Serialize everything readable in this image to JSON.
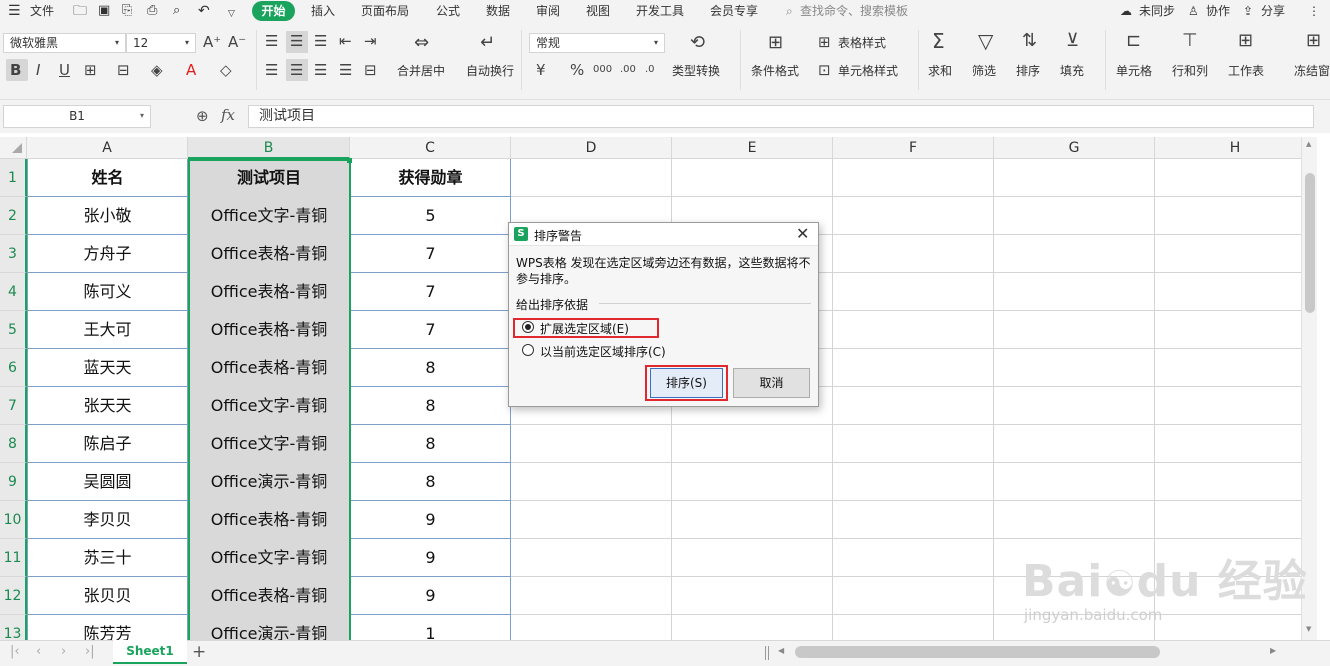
{
  "menubar": {
    "file": "文件",
    "tabs": [
      "开始",
      "插入",
      "页面布局",
      "公式",
      "数据",
      "审阅",
      "视图",
      "开发工具",
      "会员专享"
    ],
    "search_placeholder": "查找命令、搜索模板",
    "sync": "未同步",
    "collab": "协作",
    "share": "分享"
  },
  "toolbar": {
    "font_name": "微软雅黑",
    "font_size": "12",
    "number_format": "常规",
    "merge_center": "合并居中",
    "wrap_text": "自动换行",
    "type_convert": "类型转换",
    "conditional_format": "条件格式",
    "table_style": "表格样式",
    "cell_style": "单元格样式",
    "sum": "求和",
    "filter": "筛选",
    "sort": "排序",
    "fill": "填充",
    "cell": "单元格",
    "row_col": "行和列",
    "worksheet": "工作表",
    "freeze": "冻结窗"
  },
  "formula_bar": {
    "cell_ref": "B1",
    "fx": "fx",
    "content": "测试项目"
  },
  "sheet": {
    "columns": [
      "A",
      "B",
      "C",
      "D",
      "E",
      "F",
      "G",
      "H"
    ],
    "row_numbers": [
      "1",
      "2",
      "3",
      "4",
      "5",
      "6",
      "7",
      "8",
      "9",
      "10",
      "11",
      "12",
      "13"
    ],
    "header": [
      "姓名",
      "测试项目",
      "获得勋章"
    ],
    "rows": [
      [
        "张小敬",
        "Office文字-青铜",
        "5"
      ],
      [
        "方舟子",
        "Office表格-青铜",
        "7"
      ],
      [
        "陈可义",
        "Office表格-青铜",
        "7"
      ],
      [
        "王大可",
        "Office表格-青铜",
        "7"
      ],
      [
        "蓝天天",
        "Office表格-青铜",
        "8"
      ],
      [
        "张天天",
        "Office文字-青铜",
        "8"
      ],
      [
        "陈启子",
        "Office文字-青铜",
        "8"
      ],
      [
        "吴圆圆",
        "Office演示-青铜",
        "8"
      ],
      [
        "李贝贝",
        "Office表格-青铜",
        "9"
      ],
      [
        "苏三十",
        "Office文字-青铜",
        "9"
      ],
      [
        "张贝贝",
        "Office表格-青铜",
        "9"
      ],
      [
        "陈芳芳",
        "Office演示-青铜",
        "1"
      ]
    ]
  },
  "sheet_tabs": {
    "active": "Sheet1",
    "add": "+"
  },
  "dialog": {
    "title": "排序警告",
    "message": "WPS表格 发现在选定区域旁边还有数据，这些数据将不参与排序。",
    "group_label": "给出排序依据",
    "option_expand": "扩展选定区域(E)",
    "option_current": "以当前选定区域排序(C)",
    "selected_option": "expand",
    "ok_label": "排序(S)",
    "cancel_label": "取消",
    "highlight_color": "#e0282e"
  },
  "colors": {
    "accent": "#1aa35d",
    "selection_fill": "#d9d9d9"
  }
}
